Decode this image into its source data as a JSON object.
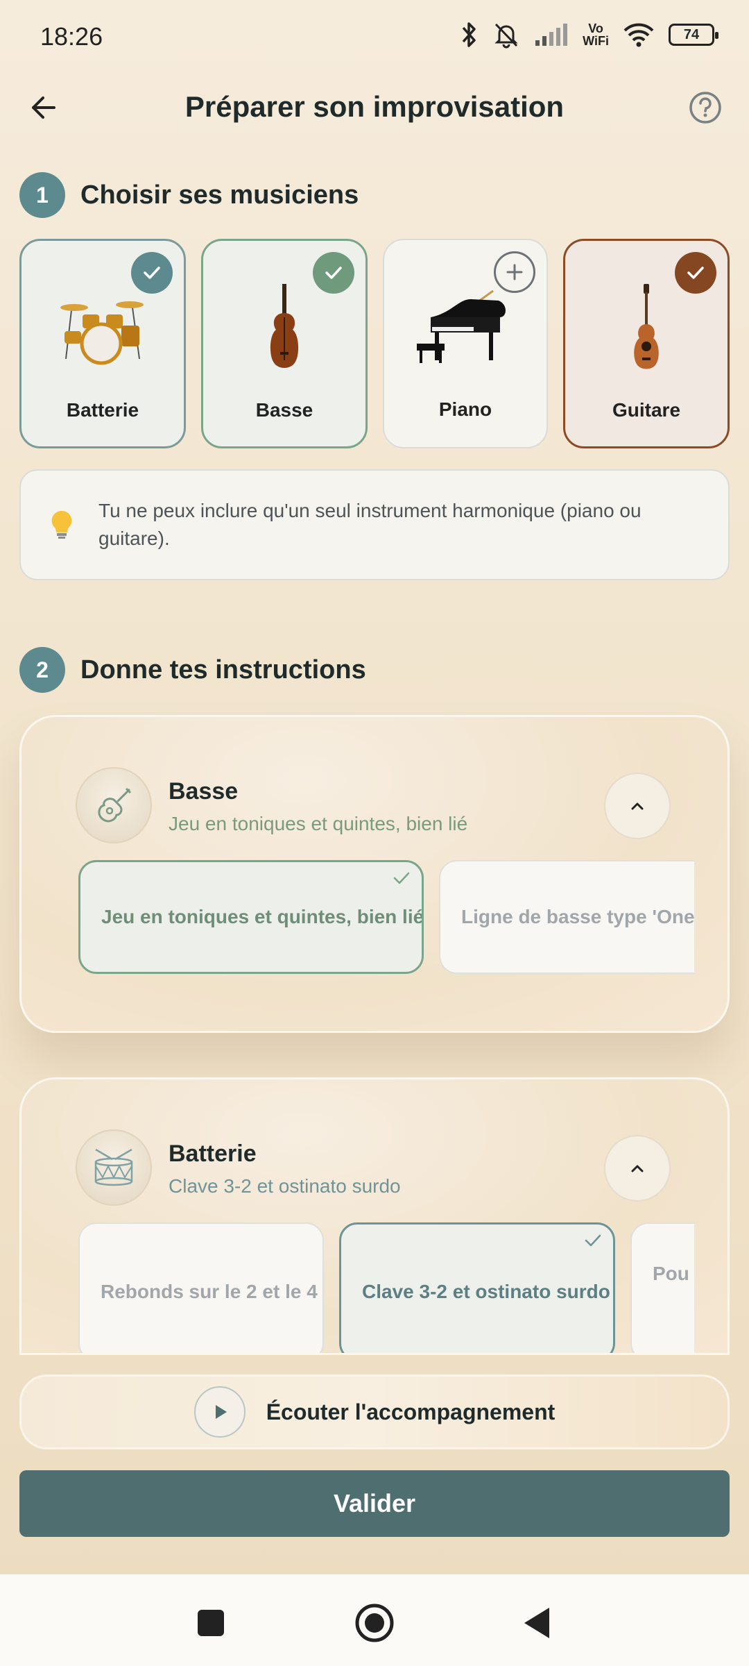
{
  "status_bar": {
    "time": "18:26",
    "battery": "74",
    "vowifi_line1": "Vo",
    "vowifi_line2": "WiFi"
  },
  "header": {
    "title": "Préparer son improvisation"
  },
  "section1": {
    "number": "1",
    "title": "Choisir ses musiciens",
    "instruments": [
      {
        "label": "Batterie",
        "selected": true
      },
      {
        "label": "Basse",
        "selected": true
      },
      {
        "label": "Piano",
        "selected": false
      },
      {
        "label": "Guitare",
        "selected": true
      }
    ],
    "tip": "Tu ne peux inclure qu'un seul instrument harmonique (piano ou guitare)."
  },
  "section2": {
    "number": "2",
    "title": "Donne tes instructions",
    "cards": [
      {
        "name": "Basse",
        "subtitle": "Jeu en toniques et quintes, bien lié",
        "options": [
          "Jeu en toniques et quintes, bien lié",
          "Ligne de basse type 'One-D"
        ]
      },
      {
        "name": "Batterie",
        "subtitle": "Clave 3-2 et ostinato surdo",
        "options": [
          "Rebonds sur le 2 et le 4",
          "Clave 3-2 et ostinato surdo",
          "Pou"
        ]
      }
    ]
  },
  "listen_label": "Écouter l'accompagnement",
  "validate_label": "Valider",
  "colors": {
    "accent_teal": "#5c8a8e",
    "accent_green": "#6f9a7c",
    "accent_brown": "#844722",
    "validate_bg": "#4f6e6f"
  }
}
